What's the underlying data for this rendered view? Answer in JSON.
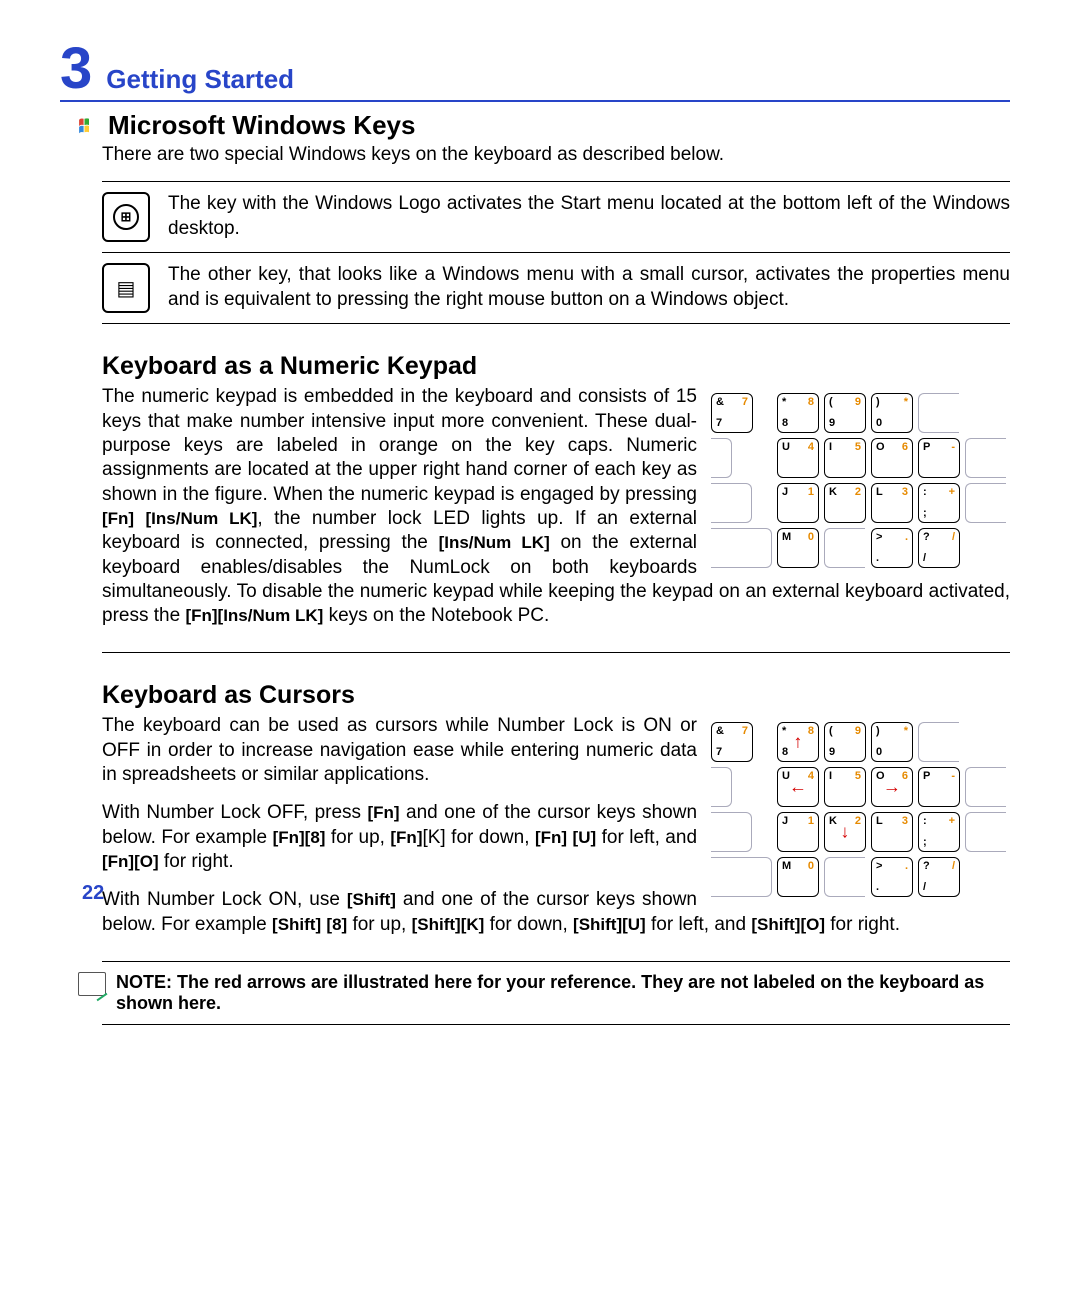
{
  "chapter": {
    "number": "3",
    "title": "Getting Started"
  },
  "section1": {
    "title": "Microsoft Windows Keys",
    "intro": "There are two special Windows keys on the keyboard as described below.",
    "key1": "The key with the Windows Logo activates the Start menu located at the bottom left of the Windows desktop.",
    "key2": "The other key, that looks like a Windows menu with a small cursor, activates the properties menu and is equivalent to pressing the right mouse button on a Windows object."
  },
  "section2": {
    "title": "Keyboard as a Numeric Keypad",
    "p1a": "The numeric keypad is embedded in the keyboard and consists of 15 keys that make number intensive input more convenient. These dual-purpose keys are labeled in orange on the key caps. Numeric assignments are located at the upper right hand corner of each key as shown in the figure. When the numeric keypad is engaged by pressing ",
    "fn": "[Fn]",
    "insnum1": "[Ins/Num LK]",
    "p1b": ", the number lock LED lights up. If an external keyboard is connected, pressing the ",
    "insnum2": "[Ins/Num LK]",
    "p1c": " on the external keyboard enables/disables the NumLock on both keyboards simultaneously. To disable the numeric keypad while keeping the keypad on an external keyboard activated, press the  ",
    "fn2": "[Fn][Ins/Num LK]",
    "p1d": " keys on the Notebook PC."
  },
  "section3": {
    "title": "Keyboard as Cursors",
    "p1": "The keyboard can be used as cursors while Number Lock is ON or OFF in order to increase navigation ease while entering numeric data in spreadsheets or similar applications.",
    "p2a": "With Number Lock OFF, press ",
    "p2_fn": "[Fn]",
    "p2b": " and one of the cursor keys shown below. For example ",
    "p2_fn8": "[Fn][8]",
    "p2c": " for up, ",
    "p2_fnK": "[Fn]",
    "p2_k": "[K] for down, ",
    "p2_fnU": "[Fn]",
    "p2_u": "[U]",
    "p2d": " for left, and ",
    "p2_fnO": "[Fn][O]",
    "p2e": " for right.",
    "p3a": "With Number Lock ON, use ",
    "p3_shift": "[Shift]",
    "p3b": " and one of the cursor keys shown below. For example ",
    "p3_s8": "[Shift]",
    "p3_8": "[8]",
    "p3c": " for up, ",
    "p3_sK": "[Shift][K]",
    "p3d": " for down, ",
    "p3_sU": "[Shift][U]",
    "p3e": " for left, and ",
    "p3_sO": "[Shift][O]",
    "p3f": " for right."
  },
  "note": "NOTE: The red arrows are illustrated here for your reference. They are not labeled on the keyboard as shown here.",
  "page_number": "22",
  "keypad": {
    "row1": [
      {
        "tl": "&",
        "tr": "7",
        "bl": "7",
        "br": ""
      },
      {
        "tl": "*",
        "tr": "8",
        "bl": "8",
        "br": ""
      },
      {
        "tl": "(",
        "tr": "9",
        "bl": "9",
        "br": ""
      },
      {
        "tl": ")",
        "tr": "*",
        "bl": "0",
        "br": ""
      },
      {
        "blank": true
      }
    ],
    "row2": [
      {
        "half": true
      },
      {
        "tl": "U",
        "tr": "4",
        "bl": "",
        "br": ""
      },
      {
        "tl": "I",
        "tr": "5",
        "bl": "",
        "br": ""
      },
      {
        "tl": "O",
        "tr": "6",
        "bl": "",
        "br": ""
      },
      {
        "tl": "P",
        "tr": "-",
        "bl": "",
        "br": ""
      },
      {
        "blank": true
      }
    ],
    "row3": [
      {
        "half": true,
        "wide": true
      },
      {
        "tl": "J",
        "tr": "1",
        "bl": "",
        "br": ""
      },
      {
        "tl": "K",
        "tr": "2",
        "bl": "",
        "br": ""
      },
      {
        "tl": "L",
        "tr": "3",
        "bl": "",
        "br": ""
      },
      {
        "tl": ":",
        "tr": "+",
        "bl": ";",
        "br": ""
      },
      {
        "blank": true
      }
    ],
    "row4": [
      {
        "half": true,
        "wider": true
      },
      {
        "tl": "M",
        "tr": "0",
        "bl": "",
        "br": ""
      },
      {
        "blank": true
      },
      {
        "tl": ">",
        "tr": ".",
        "bl": ".",
        "br": ""
      },
      {
        "tl": "?",
        "tr": "/",
        "bl": "/",
        "br": ""
      }
    ]
  },
  "keypad_cursors": {
    "arrows": {
      "up": "↑",
      "down": "↓",
      "left": "←",
      "right": "→"
    }
  }
}
